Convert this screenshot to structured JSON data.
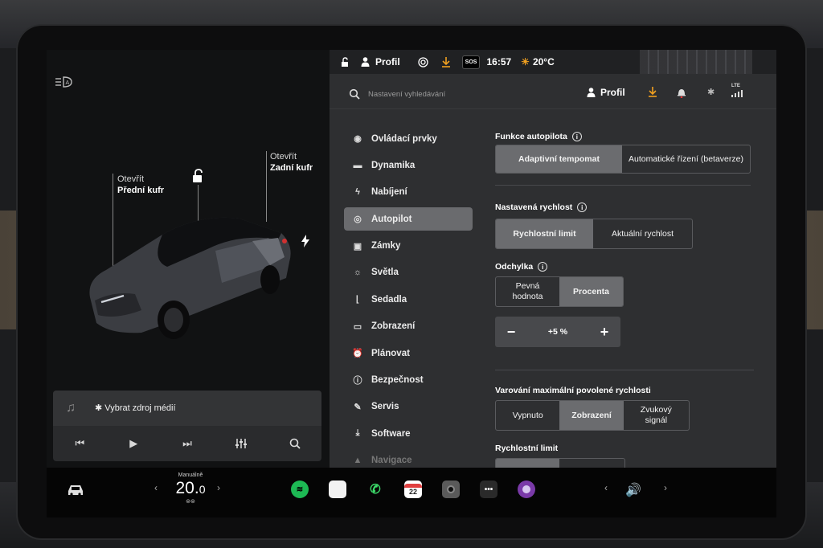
{
  "status_bar": {
    "profile_label": "Profil",
    "sos_label": "SOS",
    "time": "16:57",
    "temperature": "20°C"
  },
  "header": {
    "search_placeholder": "Nastavení vyhledávání",
    "profile_label": "Profil",
    "lte_label": "LTE"
  },
  "car_view": {
    "front_trunk": {
      "line1": "Otevřít",
      "line2": "Přední kufr"
    },
    "rear_trunk": {
      "line1": "Otevřít",
      "line2": "Zadní kufr"
    }
  },
  "media": {
    "source_label": "Vybrat zdroj médií"
  },
  "menu": {
    "items": [
      {
        "label": "Ovládací prvky",
        "icon": "toggle-icon"
      },
      {
        "label": "Dynamika",
        "icon": "car-icon"
      },
      {
        "label": "Nabíjení",
        "icon": "bolt-icon"
      },
      {
        "label": "Autopilot",
        "icon": "steering-wheel-icon",
        "active": true
      },
      {
        "label": "Zámky",
        "icon": "lock-icon"
      },
      {
        "label": "Světla",
        "icon": "sun-icon"
      },
      {
        "label": "Sedadla",
        "icon": "seat-icon"
      },
      {
        "label": "Zobrazení",
        "icon": "display-icon"
      },
      {
        "label": "Plánovat",
        "icon": "alarm-icon"
      },
      {
        "label": "Bezpečnost",
        "icon": "alert-icon"
      },
      {
        "label": "Servis",
        "icon": "wrench-icon"
      },
      {
        "label": "Software",
        "icon": "download-icon"
      },
      {
        "label": "Navigace",
        "icon": "navigation-icon"
      }
    ]
  },
  "autopilot": {
    "features_title": "Funkce autopilota",
    "features_options": [
      "Adaptivní tempomat",
      "Automatické řízení (betaverze)"
    ],
    "speed_title": "Nastavená rychlost",
    "speed_options": [
      "Rychlostní limit",
      "Aktuální rychlost"
    ],
    "offset_title": "Odchylka",
    "offset_options": [
      "Pevná hodnota",
      "Procenta"
    ],
    "offset_value": "+5 %",
    "warning_title": "Varování maximální povolené rychlosti",
    "warning_options": [
      "Vypnuto",
      "Zobrazení",
      "Zvukový signál"
    ],
    "limit_title": "Rychlostní limit"
  },
  "dock": {
    "climate_mode": "Manuálně",
    "climate_temp_int": "20.",
    "climate_temp_dec": "0",
    "calendar_day": "22"
  },
  "colors": {
    "accent_orange": "#f0a020",
    "selected_segment": "#6b6c6f",
    "panel_bg": "#2e2f31"
  }
}
